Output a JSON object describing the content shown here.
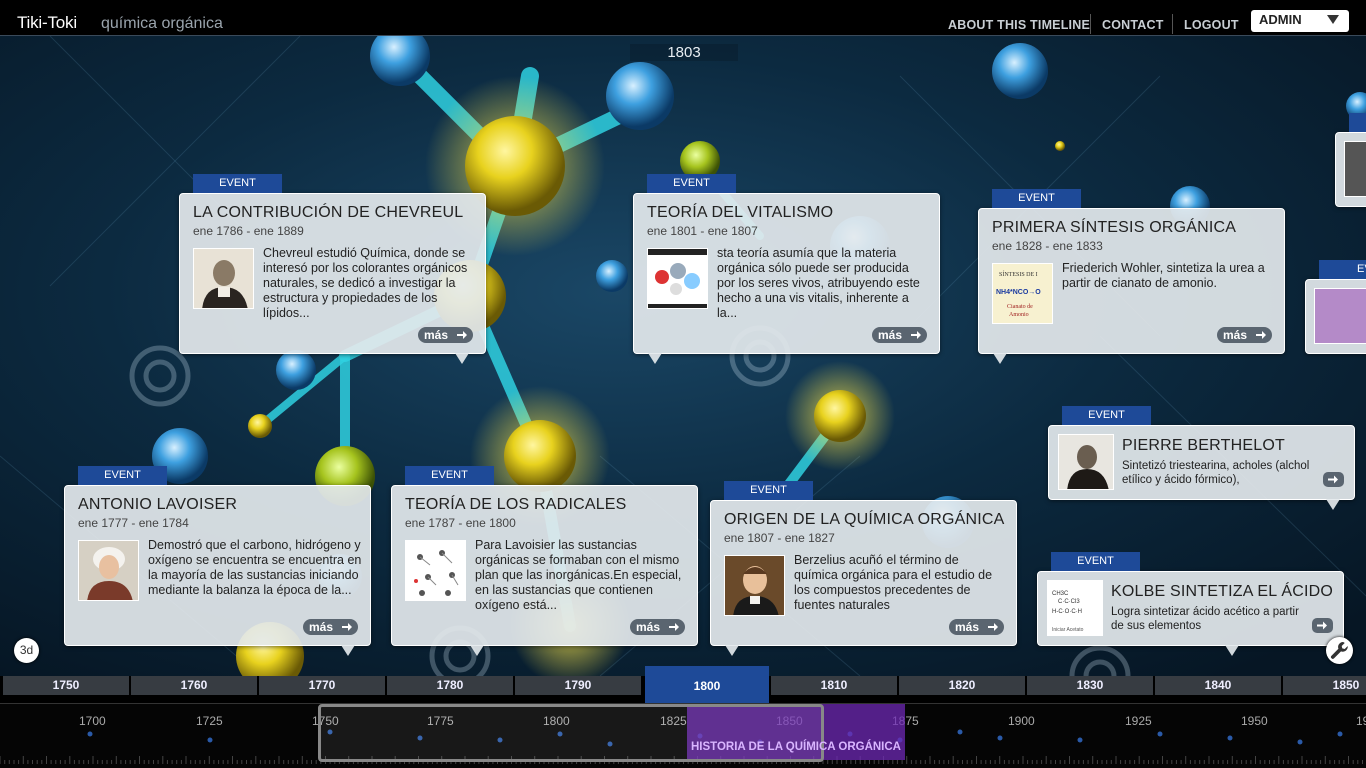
{
  "header": {
    "app_title": "Tiki-Toki",
    "timeline_name": "química orgánica",
    "nav": {
      "about": "ABOUT THIS TIMELINE",
      "contact": "CONTACT",
      "logout": "LOGOUT"
    },
    "user_select": "ADMIN"
  },
  "current_year": "1803",
  "cards": [
    {
      "tag": "EVENT",
      "title": "LA CONTRIBUCIÓN DE CHEVREUL",
      "date": "ene 1786 - ene 1889",
      "desc": "Chevreul estudió Química, donde se interesó por los colorantes orgánicos naturales, se dedicó a investigar la estructura y propiedades de los lípidos...",
      "more": "más"
    },
    {
      "tag": "EVENT",
      "title": "TEORÍA DEL VITALISMO",
      "date": "ene 1801 - ene 1807",
      "desc": "sta teoría asumía que la materia orgánica sólo puede ser producida por los seres vivos, atribuyendo este hecho a una vis vitalis, inherente a la...",
      "more": "más"
    },
    {
      "tag": "EVENT",
      "title": "PRIMERA SÍNTESIS ORGÁNICA",
      "date": "ene 1828 - ene 1833",
      "desc": "Friederich Wohler, sintetiza la urea a partir de cianato de amonio.",
      "more": "más"
    },
    {
      "tag": "EVENT",
      "title": "PIERRE BERTHELOT",
      "date": "",
      "desc": "Sintetizó triestearina, acholes (alchol etílico y ácido fórmico),",
      "more": ""
    },
    {
      "tag": "EVENT",
      "title": "ANTONIO LAVOISER",
      "date": "ene 1777 - ene 1784",
      "desc": "Demostró que el carbono, hidrógeno y oxígeno se encuentra se encuentra en la mayoría de las sustancias iniciando mediante la balanza la época de la...",
      "more": "más"
    },
    {
      "tag": "EVENT",
      "title": "TEORÍA DE LOS RADICALES",
      "date": "ene 1787 - ene 1800",
      "desc": "Para Lavoisier las sustancias orgánicas se formaban con el mismo plan que las inorgánicas.En especial, en las sustancias que contienen oxígeno está...",
      "more": "más"
    },
    {
      "tag": "EVENT",
      "title": "ORIGEN DE LA QUÍMICA ORGÁNICA",
      "date": "ene 1807 - ene 1827",
      "desc": "Berzelius acuñó el término de química orgánica para el estudio de los compuestos precedentes de fuentes naturales",
      "more": "más"
    },
    {
      "tag": "EVENT",
      "title": "KOLBE SINTETIZA EL ÁCIDO",
      "date": "",
      "desc": "Logra sintetizar ácido acético a partir de sus elementos",
      "more": ""
    }
  ],
  "partial_tag": "EVE",
  "thumb_texts": {
    "wohler": [
      "SÍNTESIS DE I",
      "NH4*NCO→O",
      "Cianato de",
      "Amonio"
    ],
    "kolbe": [
      "CH3C",
      "C·C·Cl3",
      "H-C·O·C·H",
      "Iniciar Acetato"
    ]
  },
  "decades": [
    "1750",
    "1760",
    "1770",
    "1780",
    "1790",
    "1800",
    "1810",
    "1820",
    "1830",
    "1840",
    "1850"
  ],
  "nav_years": [
    "1700",
    "1725",
    "1750",
    "1775",
    "1800",
    "1825",
    "1850",
    "1875",
    "1900",
    "1925",
    "1950",
    "19"
  ],
  "category_label": "HISTORIA DE LA QUÍMICA ORGÁNICA",
  "controls": {
    "view_3d": "3d"
  },
  "colors": {
    "tag_blue": "#1e4a98",
    "category_purple": "#6e28b4",
    "background": "#0d2a3e"
  }
}
